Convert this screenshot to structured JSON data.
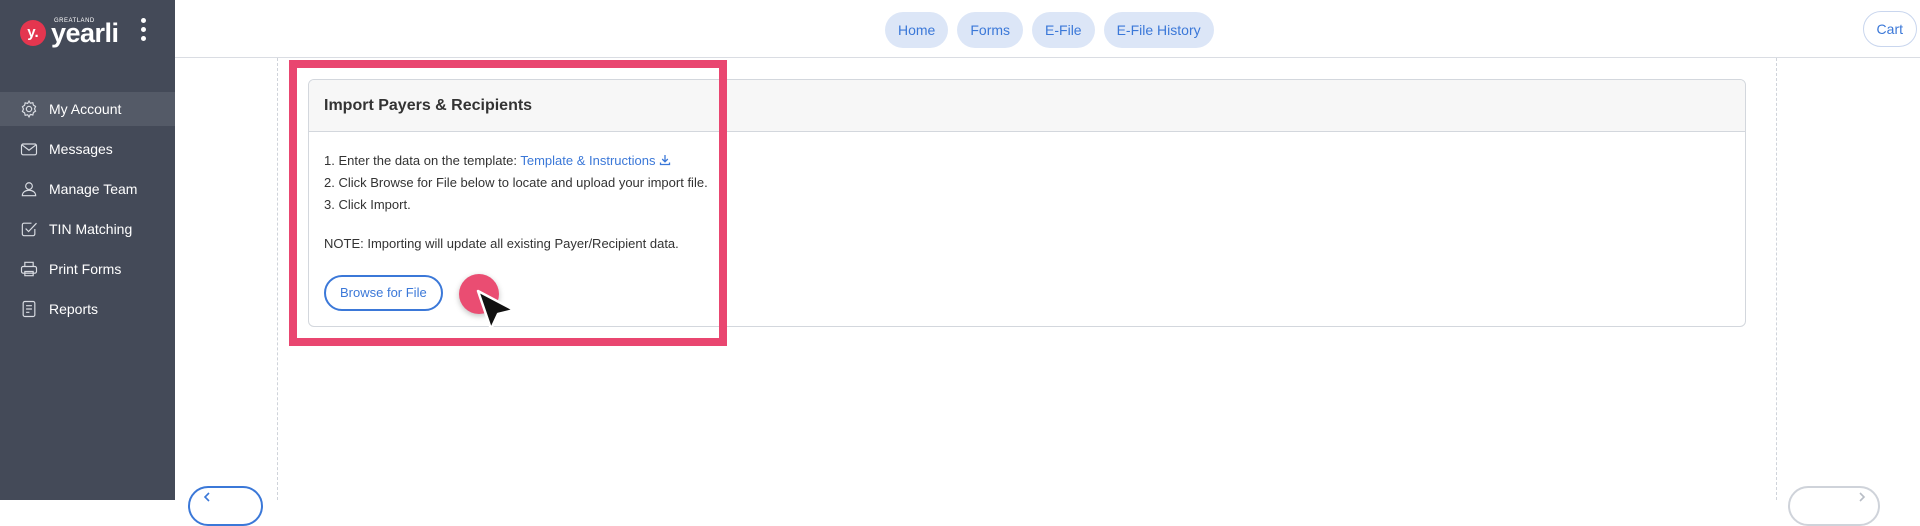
{
  "brand": {
    "badge": "y.",
    "small_text": "GREATLAND",
    "wordmark": "yearli",
    "badge_color": "#e4364f"
  },
  "sidebar": {
    "background": "#444a58",
    "items": [
      {
        "label": "My Account",
        "icon": "gear-icon",
        "active": true
      },
      {
        "label": "Messages",
        "icon": "envelope-icon"
      },
      {
        "label": "Manage Team",
        "icon": "user-icon"
      },
      {
        "label": "TIN Matching",
        "icon": "checkbox-icon"
      },
      {
        "label": "Print Forms",
        "icon": "printer-icon"
      },
      {
        "label": "Reports",
        "icon": "document-icon"
      }
    ]
  },
  "topnav": {
    "pills": [
      "Home",
      "Forms",
      "E-File",
      "E-File History"
    ],
    "cart": "Cart",
    "accent": "#3b78d8"
  },
  "import_card": {
    "title": "Import Payers & Recipients",
    "step1_prefix": "1. Enter the data on the template: ",
    "step1_link": "Template & Instructions",
    "step2": "2. Click Browse for File below to locate and upload your import file.",
    "step3": "3. Click Import.",
    "note": "NOTE: Importing will update all existing Payer/Recipient data.",
    "browse_button": "Browse for File"
  },
  "overlay": {
    "highlight_color": "#e94670",
    "cursor": "arrow-cursor-icon"
  }
}
